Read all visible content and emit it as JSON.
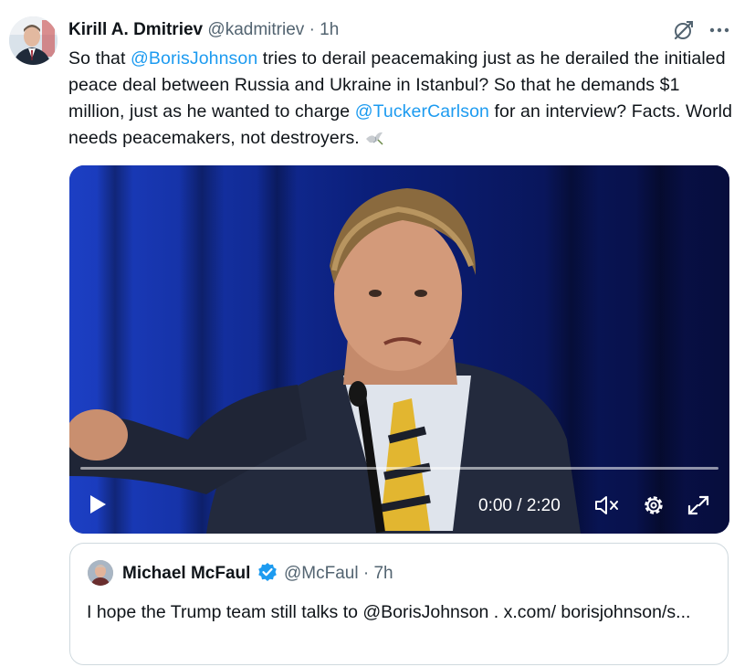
{
  "tweet": {
    "author_name": "Kirill A. Dmitriev",
    "handle": "@kadmitriev",
    "separator": "·",
    "time": "1h",
    "text_parts": [
      "So that ",
      "@BorisJohnson",
      " tries to derail peacemaking just as he derailed the initialed peace deal between Russia and Ukraine in Istanbul? So that he demands $1 million, just as he wanted to charge ",
      "@TuckerCarlson",
      " for an interview? Facts. World needs peacemakers, not destroyers. "
    ]
  },
  "video": {
    "time_readout": "0:00 / 2:20",
    "progress": 0
  },
  "quote": {
    "author_name": "Michael McFaul",
    "handle": "@McFaul",
    "separator": "·",
    "time": "7h",
    "text": "I hope the Trump team still talks to @BorisJohnson . x.com/ borisjohnson/s..."
  },
  "colors": {
    "link": "#1d9bf0",
    "secondary_text": "#536471",
    "verified": "#1d9bf0",
    "border": "#cfd9de"
  },
  "icons": [
    "grok-icon",
    "more-icon",
    "dove-icon",
    "play-icon",
    "mute-icon",
    "settings-icon",
    "fullscreen-icon",
    "verified-icon"
  ]
}
